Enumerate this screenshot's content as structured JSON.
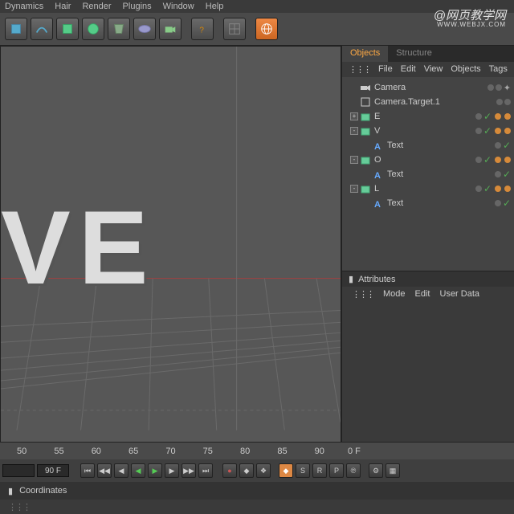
{
  "menu": [
    "Dynamics",
    "Hair",
    "Render",
    "Plugins",
    "Window",
    "Help"
  ],
  "watermark": {
    "main": "@网页教学网",
    "sub": "WWW.WEBJX.COM"
  },
  "tabs": {
    "objects": "Objects",
    "structure": "Structure"
  },
  "submenu": [
    "File",
    "Edit",
    "View",
    "Objects",
    "Tags"
  ],
  "objects": [
    {
      "indent": 0,
      "icon": "camera",
      "name": "Camera",
      "tree": "",
      "tags": [
        "dot",
        "dot",
        "target"
      ]
    },
    {
      "indent": 0,
      "icon": "null",
      "name": "Camera.Target.1",
      "tree": "",
      "tags": [
        "dot",
        "dot"
      ]
    },
    {
      "indent": 0,
      "icon": "extrude",
      "name": "E",
      "tree": "+",
      "tags": [
        "dot",
        "check",
        "orange",
        "orange"
      ]
    },
    {
      "indent": 0,
      "icon": "extrude",
      "name": "V",
      "tree": "-",
      "tags": [
        "dot",
        "check",
        "orange",
        "orange"
      ]
    },
    {
      "indent": 1,
      "icon": "text",
      "name": "Text",
      "tree": "",
      "tags": [
        "dot",
        "check"
      ]
    },
    {
      "indent": 0,
      "icon": "extrude",
      "name": "O",
      "tree": "-",
      "tags": [
        "dot",
        "check",
        "orange",
        "orange"
      ]
    },
    {
      "indent": 1,
      "icon": "text",
      "name": "Text",
      "tree": "",
      "tags": [
        "dot",
        "check"
      ]
    },
    {
      "indent": 0,
      "icon": "extrude",
      "name": "L",
      "tree": "-",
      "tags": [
        "dot",
        "check",
        "orange",
        "orange"
      ]
    },
    {
      "indent": 1,
      "icon": "text",
      "name": "Text",
      "tree": "",
      "tags": [
        "dot",
        "check"
      ]
    }
  ],
  "attributes": {
    "title": "Attributes",
    "menu": [
      "Mode",
      "Edit",
      "User Data"
    ]
  },
  "timeline": {
    "ticks": [
      "50",
      "55",
      "60",
      "65",
      "70",
      "75",
      "80",
      "85",
      "90"
    ],
    "current": "0 F",
    "end": "90 F"
  },
  "coordinates": {
    "title": "Coordinates"
  },
  "viewport_text": "VE"
}
